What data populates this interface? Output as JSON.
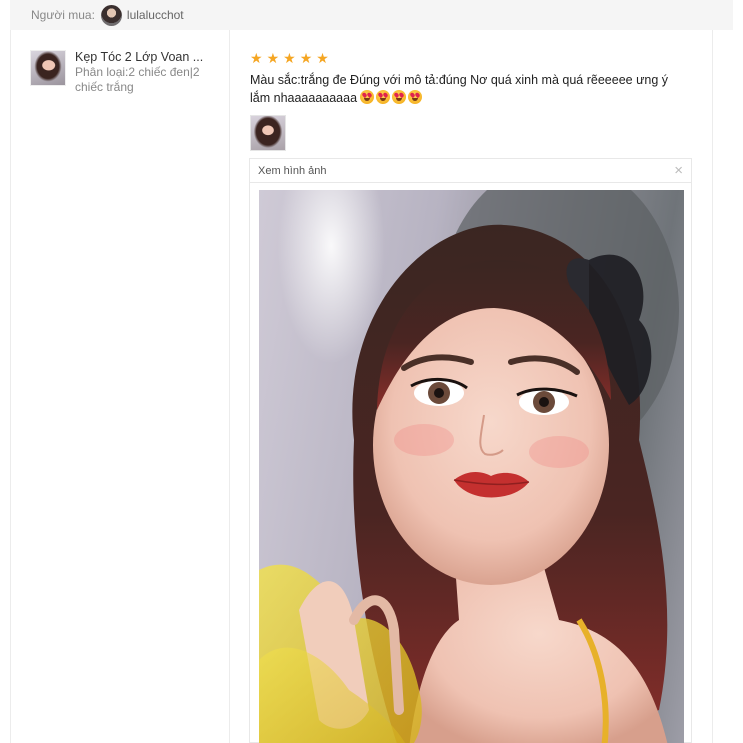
{
  "buyer": {
    "label": "Người mua:",
    "name": "lulalucchot",
    "avatar_icon": "buyer-avatar"
  },
  "product": {
    "name": "Kẹp Tóc 2 Lớp Voan ...",
    "variant": "Phân loại:2 chiếc đen|2 chiếc trắng",
    "thumbnail_icon": "product-thumbnail"
  },
  "review": {
    "rating": 5,
    "stars": [
      "★",
      "★",
      "★",
      "★",
      "★"
    ],
    "comment": "Màu sắc:trắng đe Đúng với mô tả:đúng Nơ quá xinh mà quá rẽeeeee ưng ý lắm nhaaaaaaaaaa",
    "emoji_icons": [
      "heart-eyes-emoji",
      "heart-eyes-emoji",
      "heart-eyes-emoji",
      "heart-eyes-emoji"
    ],
    "star_color": "#f5a623"
  },
  "viewer": {
    "title": "Xem hình ảnh",
    "close_icon": "×"
  }
}
